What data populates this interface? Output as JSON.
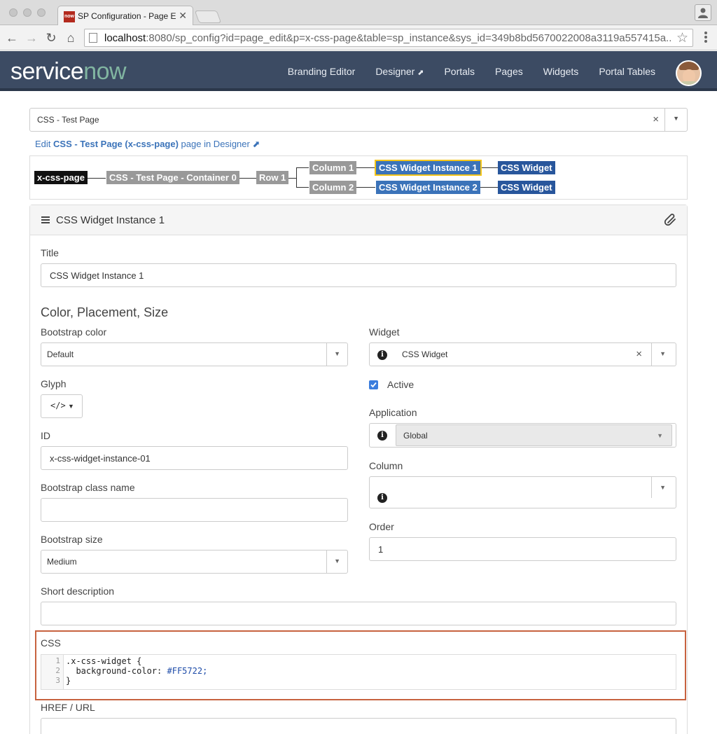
{
  "browser": {
    "tab_title": "SP Configuration - Page Ed",
    "tab_favicon": "now",
    "url_host": "localhost",
    "url_rest": ":8080/sp_config?id=page_edit&p=x-css-page&table=sp_instance&sys_id=349b8bd5670022008a3119a557415a..."
  },
  "header": {
    "logo_service": "service",
    "logo_now": "now",
    "nav": [
      {
        "label": "Branding Editor",
        "external": false
      },
      {
        "label": "Designer",
        "external": true
      },
      {
        "label": "Portals",
        "external": false
      },
      {
        "label": "Pages",
        "external": false
      },
      {
        "label": "Widgets",
        "external": false
      },
      {
        "label": "Portal Tables",
        "external": false
      }
    ]
  },
  "page_select": {
    "value": "CSS - Test Page"
  },
  "edit_link": {
    "prefix": "Edit ",
    "page": "CSS - Test Page (x-css-page)",
    "suffix": " page in Designer"
  },
  "tree": {
    "root": "x-css-page",
    "container": "CSS - Test Page - Container 0",
    "row": "Row 1",
    "column1": "Column 1",
    "column2": "Column 2",
    "instance1": "CSS Widget Instance 1",
    "instance2": "CSS Widget Instance 2",
    "widget1": "CSS Widget",
    "widget2": "CSS Widget"
  },
  "panel": {
    "title": "CSS Widget Instance 1",
    "title_label": "Title",
    "title_value": "CSS Widget Instance 1",
    "section": "Color, Placement, Size",
    "bootstrap_color_label": "Bootstrap color",
    "bootstrap_color_value": "Default",
    "glyph_label": "Glyph",
    "glyph_value": "</>",
    "id_label": "ID",
    "id_value": "x-css-widget-instance-01",
    "class_label": "Bootstrap class name",
    "class_value": "",
    "size_label": "Bootstrap size",
    "size_value": "Medium",
    "short_desc_label": "Short description",
    "short_desc_value": "",
    "widget_label": "Widget",
    "widget_value": "CSS Widget",
    "active_label": "Active",
    "active_checked": true,
    "application_label": "Application",
    "application_value": "Global",
    "column_label": "Column",
    "column_value": "",
    "order_label": "Order",
    "order_value": "1",
    "css_label": "CSS",
    "css_lines": [
      ".x-css-widget {",
      "  background-color: ",
      "}"
    ],
    "css_hex": "#FF5722;",
    "line_numbers": [
      "1",
      "2",
      "3"
    ],
    "href_label": "HREF / URL"
  },
  "colors": {
    "header_bg": "#3c4b63",
    "logo_now": "#81b5a1",
    "link": "#3b73b9",
    "selected_outline": "#f5c518",
    "css_highlight": "#c7623f"
  }
}
